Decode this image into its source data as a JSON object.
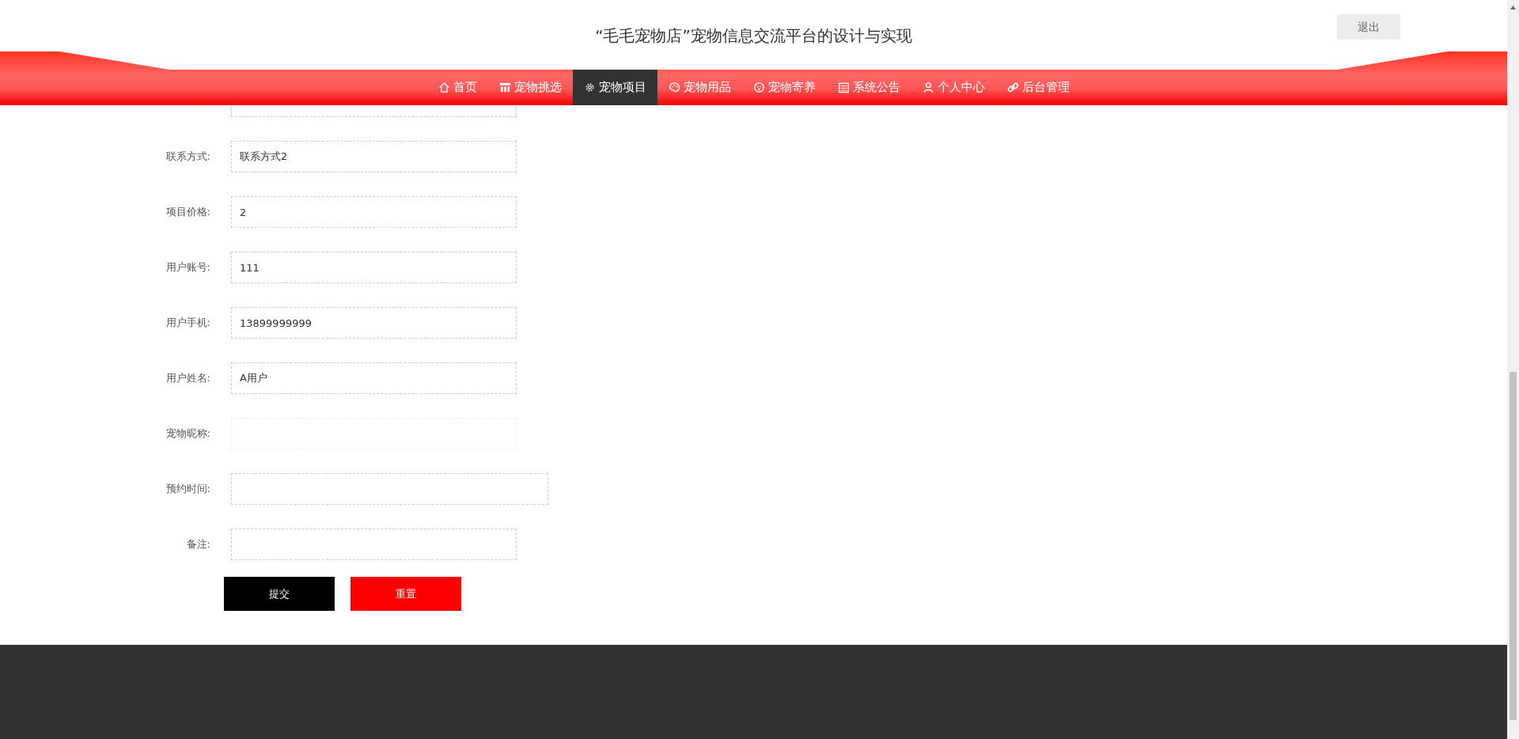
{
  "header": {
    "title": "“毛毛宠物店”宠物信息交流平台的设计与实现",
    "logout_button": "退出"
  },
  "nav": [
    {
      "label": "首页",
      "selected": false
    },
    {
      "label": "宠物挑选",
      "selected": false
    },
    {
      "label": "宠物项目",
      "selected": true
    },
    {
      "label": "宠物用品",
      "selected": false
    },
    {
      "label": "宠物寄养",
      "selected": false
    },
    {
      "label": "系统公告",
      "selected": false
    },
    {
      "label": "个人中心",
      "selected": false
    },
    {
      "label": "后台管理",
      "selected": false
    }
  ],
  "form": {
    "fields": [
      {
        "kind": "partial"
      },
      {
        "kind": "text",
        "label": "联系方式:",
        "value": "联系方式2",
        "disabled": false
      },
      {
        "kind": "text",
        "label": "项目价格:",
        "value": "2",
        "disabled": false
      },
      {
        "kind": "text",
        "label": "用户账号:",
        "value": "111",
        "disabled": false
      },
      {
        "kind": "text",
        "label": "用户手机:",
        "value": "13899999999",
        "disabled": false
      },
      {
        "kind": "text",
        "label": "用户姓名:",
        "value": "A用户",
        "disabled": false
      },
      {
        "kind": "text",
        "label": "宠物昵称:",
        "disabled": true
      },
      {
        "kind": "wide",
        "label": "预约时间:",
        "disabled": false
      },
      {
        "kind": "text",
        "label": "备注:",
        "disabled": false
      }
    ],
    "buttons": [
      {
        "label": "提交",
        "kind": "submit"
      },
      {
        "label": "重置",
        "kind": "reset"
      }
    ]
  }
}
